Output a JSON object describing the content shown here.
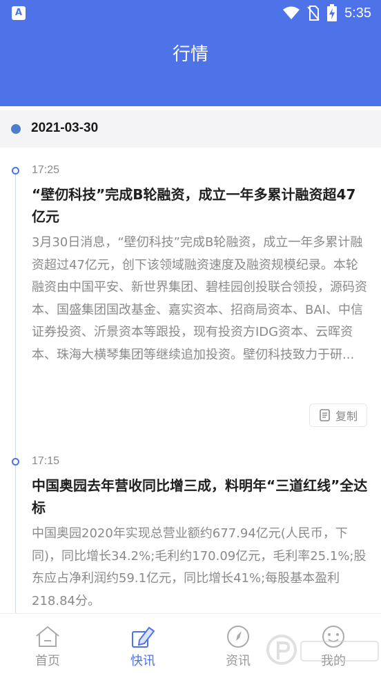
{
  "status_bar": {
    "app_icon_letter": "A",
    "time": "5:35"
  },
  "header": {
    "title": "行情"
  },
  "date_section": {
    "date": "2021-03-30"
  },
  "news": [
    {
      "time": "17:25",
      "title": "“壁仞科技”完成B轮融资，成立一年多累计融资超47亿元",
      "body": "3月30日消息，“壁仞科技”完成B轮融资，成立一年多累计融资超过47亿元，创下该领域融资速度及融资规模纪录。本轮融资由中国平安、新世界集团、碧桂园创投联合领投，源码资本、国盛集团国改基金、嘉实资本、招商局资本、BAI、中信证券投资、沂景资本等跟投，现有投资方IDG资本、云晖资本、珠海大横琴集团等继续追加投资。壁仞科技致力于研...",
      "copy_label": "复制"
    },
    {
      "time": "17:15",
      "title": "中国奥园去年营收同比增三成，料明年“三道红线”全达标",
      "body": "中国奥园2020年实现总营业额约677.94亿元(人民币，下同)，同比增长34.2%;毛利约170.09亿元，毛利率25.1%;股东应占净利润约59.1亿元，同比增长41%;每股基本盈利218.84分。"
    }
  ],
  "tabs": [
    {
      "label": "首页",
      "icon": "home-icon",
      "active": false
    },
    {
      "label": "快讯",
      "icon": "pen-icon",
      "active": true
    },
    {
      "label": "资讯",
      "icon": "compass-icon",
      "active": false
    },
    {
      "label": "我的",
      "icon": "user-icon",
      "active": false
    }
  ],
  "colors": {
    "primary": "#4e73e8",
    "date_dot": "#4e7ec9",
    "date_bg": "#f4f4f6"
  }
}
